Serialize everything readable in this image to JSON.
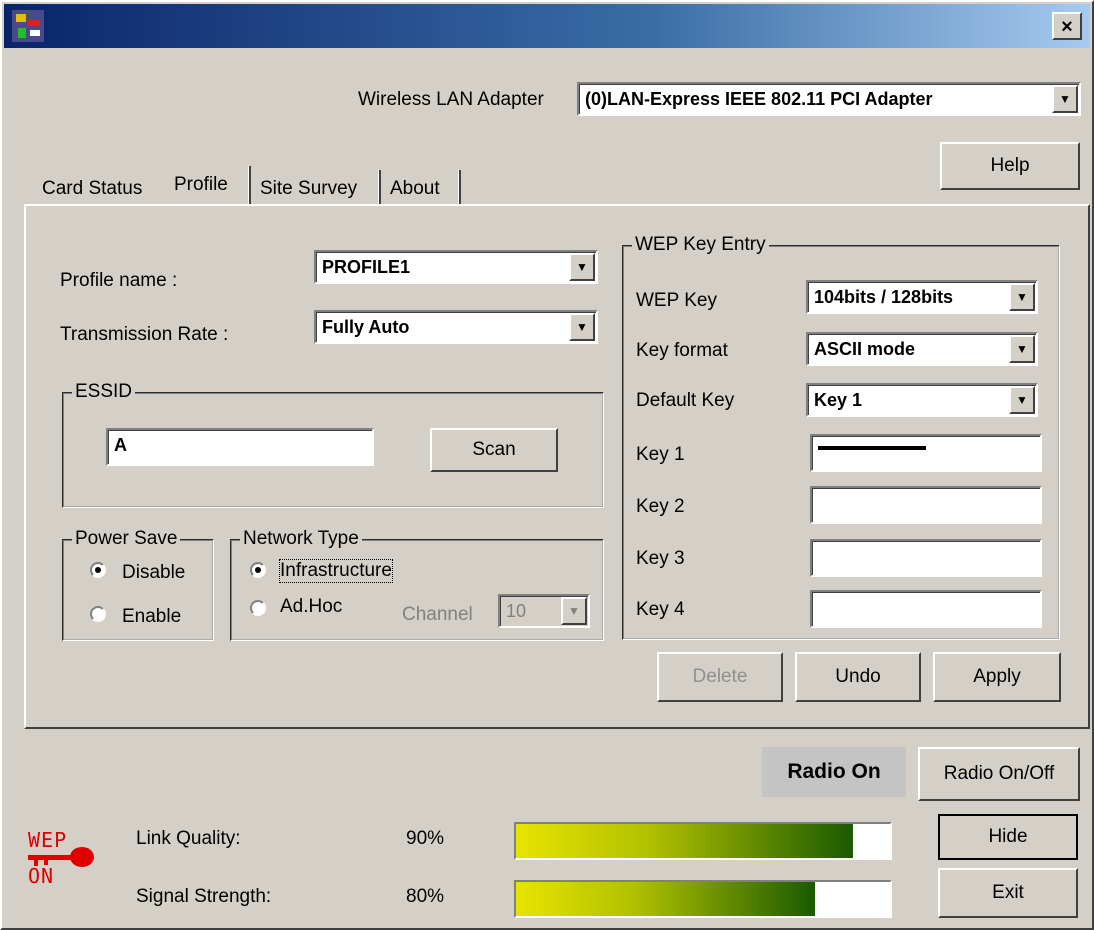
{
  "window": {
    "close_label": "×"
  },
  "adapter": {
    "label": "Wireless LAN Adapter",
    "value": "(0)LAN-Express IEEE 802.11 PCI Adapter"
  },
  "help_label": "Help",
  "tabs": [
    {
      "label": "Card Status",
      "active": false
    },
    {
      "label": "Profile",
      "active": true
    },
    {
      "label": "Site Survey",
      "active": false
    },
    {
      "label": "About",
      "active": false
    }
  ],
  "profile": {
    "name_label": "Profile name :",
    "name_value": "PROFILE1",
    "rate_label": "Transmission Rate :",
    "rate_value": "Fully Auto"
  },
  "essid": {
    "group_title": "ESSID",
    "value": "A",
    "scan_label": "Scan"
  },
  "power_save": {
    "group_title": "Power Save",
    "disable_label": "Disable",
    "enable_label": "Enable",
    "selected": "Disable"
  },
  "network_type": {
    "group_title": "Network Type",
    "infrastructure_label": "Infrastructure",
    "adhoc_label": "Ad.Hoc",
    "channel_label": "Channel",
    "channel_value": "10",
    "selected": "Infrastructure"
  },
  "wep": {
    "group_title": "WEP Key Entry",
    "wep_key_label": "WEP Key",
    "wep_key_value": "104bits / 128bits",
    "key_format_label": "Key format",
    "key_format_value": "ASCII mode",
    "default_key_label": "Default Key",
    "default_key_value": "Key 1",
    "key1_label": "Key 1",
    "key2_label": "Key 2",
    "key3_label": "Key 3",
    "key4_label": "Key 4"
  },
  "actions": {
    "delete_label": "Delete",
    "undo_label": "Undo",
    "apply_label": "Apply"
  },
  "radio": {
    "status": "Radio On",
    "toggle_label": "Radio On/Off"
  },
  "status": {
    "link_quality_label": "Link Quality:",
    "link_quality_value": "90%",
    "link_quality_level": 0.9,
    "signal_strength_label": "Signal Strength:",
    "signal_strength_value": "80%",
    "signal_strength_level": 0.8
  },
  "wep_logo": {
    "top": "WEP",
    "bottom": "ON",
    "color": "#e00000"
  },
  "bottom_buttons": {
    "hide_label": "Hide",
    "exit_label": "Exit"
  }
}
